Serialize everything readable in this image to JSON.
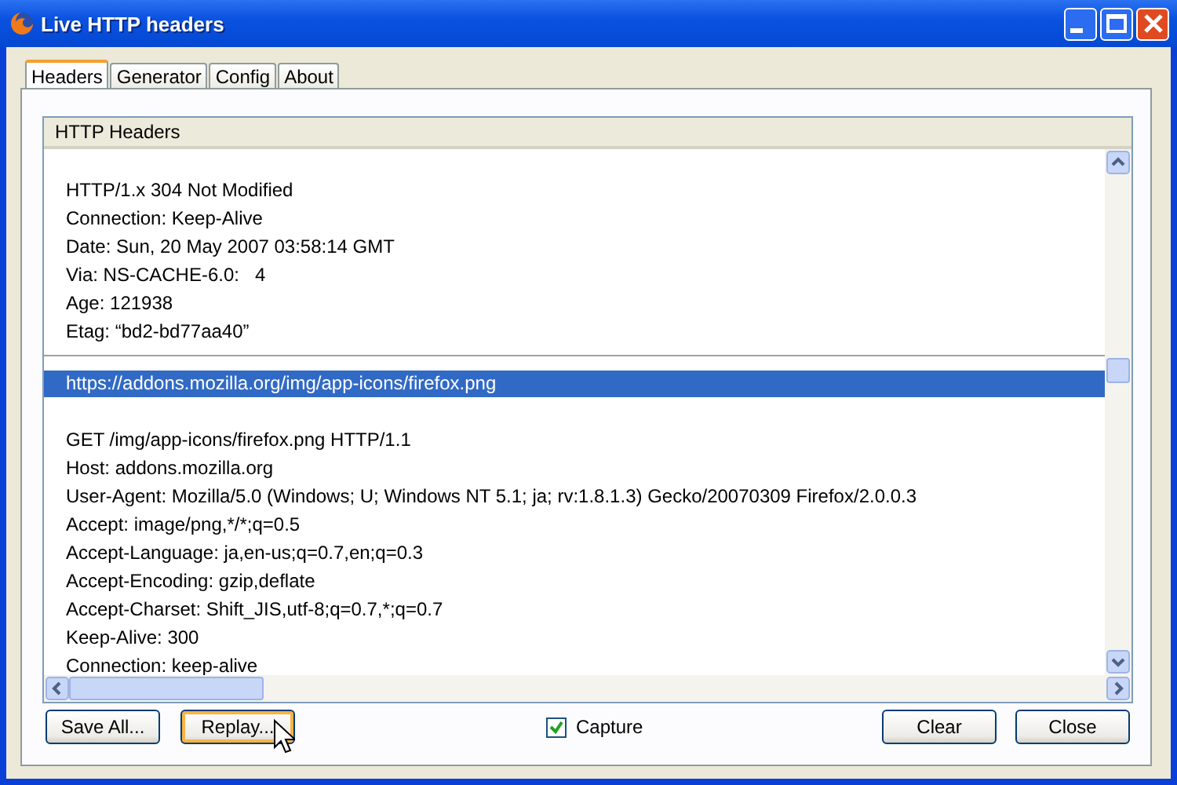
{
  "window": {
    "title": "Live HTTP headers"
  },
  "tabs": [
    {
      "label": "Headers",
      "selected": true
    },
    {
      "label": "Generator",
      "selected": false
    },
    {
      "label": "Config",
      "selected": false
    },
    {
      "label": "About",
      "selected": false
    }
  ],
  "list": {
    "header": "HTTP Headers",
    "entries": [
      {
        "kind": "block",
        "lines": [
          "HTTP/1.x 304 Not Modified",
          "Connection: Keep-Alive",
          "Date: Sun, 20 May 2007 03:58:14 GMT",
          "Via: NS-CACHE-6.0:   4",
          "Age: 121938",
          "Etag: “bd2-bd77aa40”"
        ]
      },
      {
        "kind": "url",
        "text": "https://addons.mozilla.org/img/app-icons/firefox.png",
        "selected": true
      },
      {
        "kind": "block",
        "lines": [
          "GET /img/app-icons/firefox.png HTTP/1.1",
          "Host: addons.mozilla.org",
          "User-Agent: Mozilla/5.0 (Windows; U; Windows NT 5.1; ja; rv:1.8.1.3) Gecko/20070309 Firefox/2.0.0.3",
          "Accept: image/png,*/*;q=0.5",
          "Accept-Language: ja,en-us;q=0.7,en;q=0.3",
          "Accept-Encoding: gzip,deflate",
          "Accept-Charset: Shift_JIS,utf-8;q=0.7,*;q=0.7",
          "Keep-Alive: 300",
          "Connection: keep-alive"
        ]
      }
    ]
  },
  "buttons_left": [
    {
      "label": "Save All...",
      "focused": false
    },
    {
      "label": "Replay...",
      "focused": true
    }
  ],
  "capture": {
    "label": "Capture",
    "checked": true
  },
  "buttons_right": [
    {
      "label": "Clear",
      "focused": false
    },
    {
      "label": "Close",
      "focused": false
    }
  ]
}
